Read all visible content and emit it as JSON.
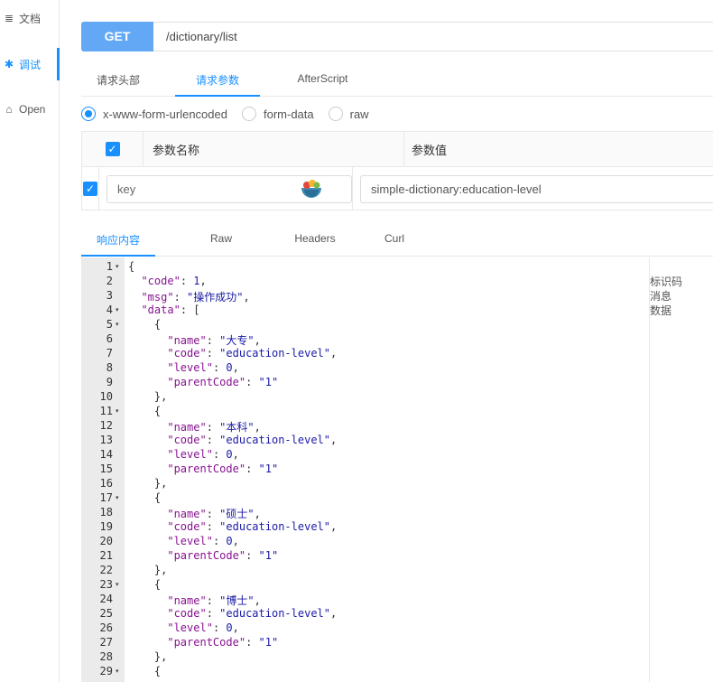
{
  "sidebar": {
    "items": [
      {
        "icon": "document-icon",
        "glyph": "≣",
        "label": "文档"
      },
      {
        "icon": "bug-icon",
        "glyph": "✱",
        "label": "调试"
      },
      {
        "icon": "home-icon",
        "glyph": "⌂",
        "label": "Open"
      }
    ]
  },
  "request": {
    "method": "GET",
    "url": "/dictionary/list"
  },
  "request_tabs": [
    "请求头部",
    "请求参数",
    "AfterScript"
  ],
  "body_types": [
    "x-www-form-urlencoded",
    "form-data",
    "raw"
  ],
  "params": {
    "header_name": "参数名称",
    "header_value": "参数值",
    "rows": [
      {
        "key_placeholder": "key",
        "value": "simple-dictionary:education-level"
      }
    ]
  },
  "response_tabs": [
    "响应内容",
    "Raw",
    "Headers",
    "Curl"
  ],
  "response": {
    "lines": [
      {
        "n": "1",
        "fold": "▾",
        "html": "{"
      },
      {
        "n": "2",
        "fold": "",
        "html": "  <span class=\"k\">\"code\"</span>: <span class=\"n\">1</span>,"
      },
      {
        "n": "3",
        "fold": "",
        "html": "  <span class=\"k\">\"msg\"</span>: <span class=\"s\">\"操作成功\"</span>,"
      },
      {
        "n": "4",
        "fold": "▾",
        "html": "  <span class=\"k\">\"data\"</span>: ["
      },
      {
        "n": "5",
        "fold": "▾",
        "html": "    {"
      },
      {
        "n": "6",
        "fold": "",
        "html": "      <span class=\"k\">\"name\"</span>: <span class=\"s\">\"大专\"</span>,"
      },
      {
        "n": "7",
        "fold": "",
        "html": "      <span class=\"k\">\"code\"</span>: <span class=\"s\">\"education-level\"</span>,"
      },
      {
        "n": "8",
        "fold": "",
        "html": "      <span class=\"k\">\"level\"</span>: <span class=\"n\">0</span>,"
      },
      {
        "n": "9",
        "fold": "",
        "html": "      <span class=\"k\">\"parentCode\"</span>: <span class=\"s\">\"1\"</span>"
      },
      {
        "n": "10",
        "fold": "",
        "html": "    },"
      },
      {
        "n": "11",
        "fold": "▾",
        "html": "    {"
      },
      {
        "n": "12",
        "fold": "",
        "html": "      <span class=\"k\">\"name\"</span>: <span class=\"s\">\"本科\"</span>,"
      },
      {
        "n": "13",
        "fold": "",
        "html": "      <span class=\"k\">\"code\"</span>: <span class=\"s\">\"education-level\"</span>,"
      },
      {
        "n": "14",
        "fold": "",
        "html": "      <span class=\"k\">\"level\"</span>: <span class=\"n\">0</span>,"
      },
      {
        "n": "15",
        "fold": "",
        "html": "      <span class=\"k\">\"parentCode\"</span>: <span class=\"s\">\"1\"</span>"
      },
      {
        "n": "16",
        "fold": "",
        "html": "    },"
      },
      {
        "n": "17",
        "fold": "▾",
        "html": "    {"
      },
      {
        "n": "18",
        "fold": "",
        "html": "      <span class=\"k\">\"name\"</span>: <span class=\"s\">\"硕士\"</span>,"
      },
      {
        "n": "19",
        "fold": "",
        "html": "      <span class=\"k\">\"code\"</span>: <span class=\"s\">\"education-level\"</span>,"
      },
      {
        "n": "20",
        "fold": "",
        "html": "      <span class=\"k\">\"level\"</span>: <span class=\"n\">0</span>,"
      },
      {
        "n": "21",
        "fold": "",
        "html": "      <span class=\"k\">\"parentCode\"</span>: <span class=\"s\">\"1\"</span>"
      },
      {
        "n": "22",
        "fold": "",
        "html": "    },"
      },
      {
        "n": "23",
        "fold": "▾",
        "html": "    {"
      },
      {
        "n": "24",
        "fold": "",
        "html": "      <span class=\"k\">\"name\"</span>: <span class=\"s\">\"博士\"</span>,"
      },
      {
        "n": "25",
        "fold": "",
        "html": "      <span class=\"k\">\"code\"</span>: <span class=\"s\">\"education-level\"</span>,"
      },
      {
        "n": "26",
        "fold": "",
        "html": "      <span class=\"k\">\"level\"</span>: <span class=\"n\">0</span>,"
      },
      {
        "n": "27",
        "fold": "",
        "html": "      <span class=\"k\">\"parentCode\"</span>: <span class=\"s\">\"1\"</span>"
      },
      {
        "n": "28",
        "fold": "",
        "html": "    },"
      },
      {
        "n": "29",
        "fold": "▾",
        "html": "    {"
      }
    ],
    "notes": [
      "标识码",
      "消息",
      "数据"
    ]
  },
  "colors": {
    "accent": "#1890ff",
    "method_bg": "#62a8f4",
    "json_key": "#881391",
    "json_string": "#1a1aa6"
  }
}
